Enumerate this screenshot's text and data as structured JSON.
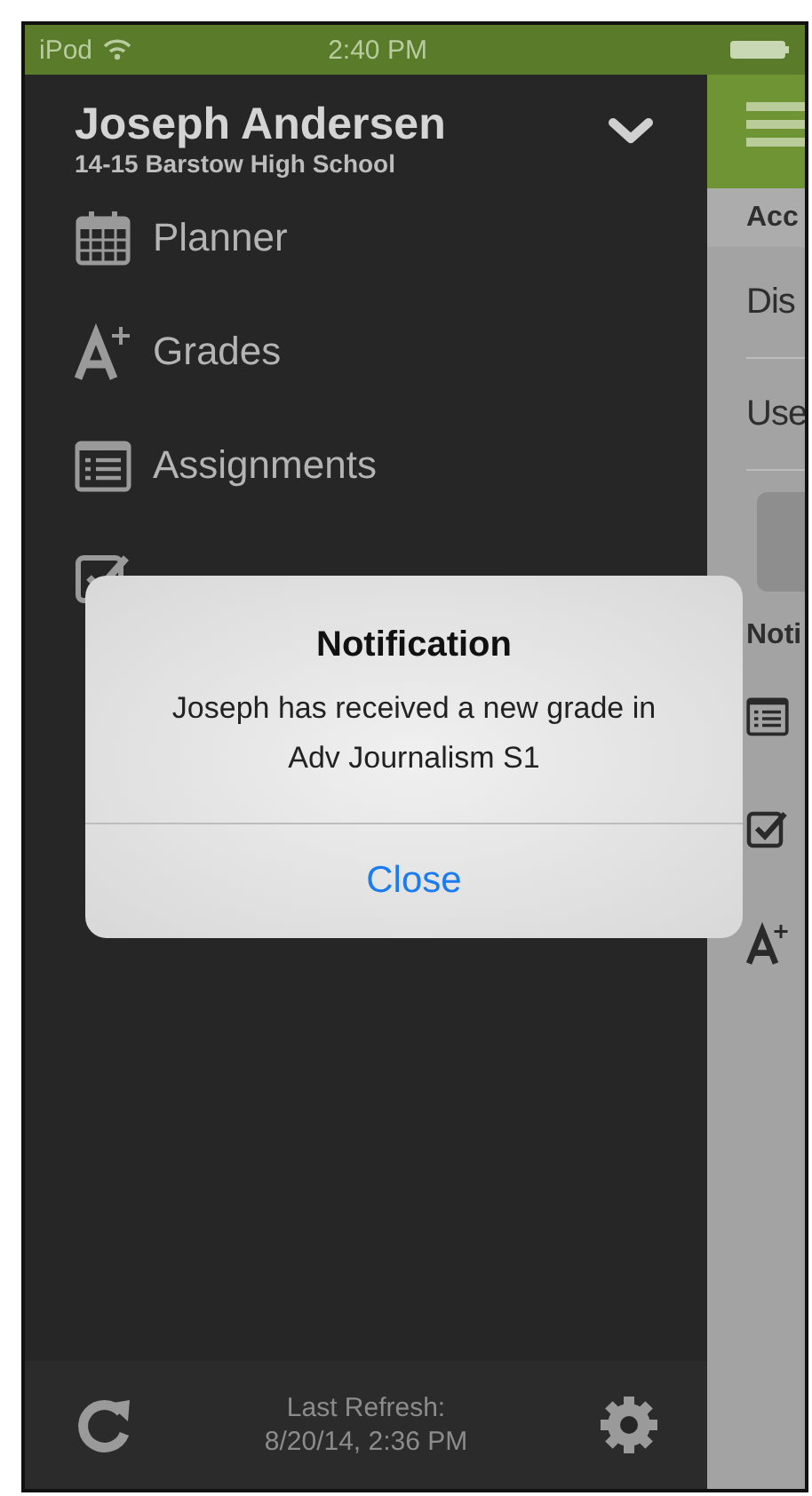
{
  "status_bar": {
    "carrier": "iPod",
    "time": "2:40 PM"
  },
  "drawer": {
    "user_name": "Joseph Andersen",
    "school": "14-15 Barstow High School",
    "menu": [
      {
        "kind": "planner",
        "label": "Planner"
      },
      {
        "kind": "grades",
        "label": "Grades"
      },
      {
        "kind": "assignments",
        "label": "Assignments"
      },
      {
        "kind": "attendance"
      }
    ],
    "footer": {
      "refresh_label": "Last Refresh:",
      "refresh_time": "8/20/14, 2:36 PM"
    }
  },
  "background_panel": {
    "account_heading": "Acc",
    "rows": [
      "Dis",
      "Use"
    ],
    "notifications_heading": "Noti",
    "notification_icons": [
      {
        "kind": "assignments"
      },
      {
        "kind": "attendance"
      },
      {
        "kind": "grades"
      }
    ]
  },
  "dialog": {
    "title": "Notification",
    "message": "Joseph has received a new grade in Adv Journalism S1",
    "button": "Close"
  }
}
